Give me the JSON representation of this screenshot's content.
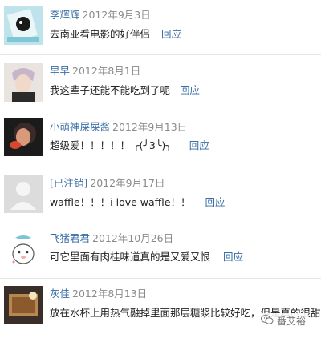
{
  "comments": [
    {
      "username": "李辉辉",
      "date": "2012年9月3日",
      "text": "去南亚看电影的好伴侣",
      "reply": "回应"
    },
    {
      "username": "早早",
      "date": "2012年8月1日",
      "text": "我这辈子还能不能吃到了呢",
      "reply": "回应"
    },
    {
      "username": "小萌神屎屎酱",
      "date": "2012年9月13日",
      "text": "超级爱！！！！！ ╭(╯3╰)╮",
      "reply": "回应"
    },
    {
      "username": "[已注销]",
      "date": "2012年9月17日",
      "text": "waffle！！！i love waffle！！",
      "reply": "回应"
    },
    {
      "username": "飞猪君君",
      "date": "2012年10月26日",
      "text": "可它里面有肉桂味道真的是又爱又恨",
      "reply": "回应"
    },
    {
      "username": "灰佳",
      "date": "2012年8月13日",
      "text": "放在水杯上用热气融掉里面那层糖浆比较好吃，但是真的很甜",
      "reply": ""
    }
  ],
  "watermark": {
    "text": "番艾裕",
    "icon": "wechat-icon"
  }
}
